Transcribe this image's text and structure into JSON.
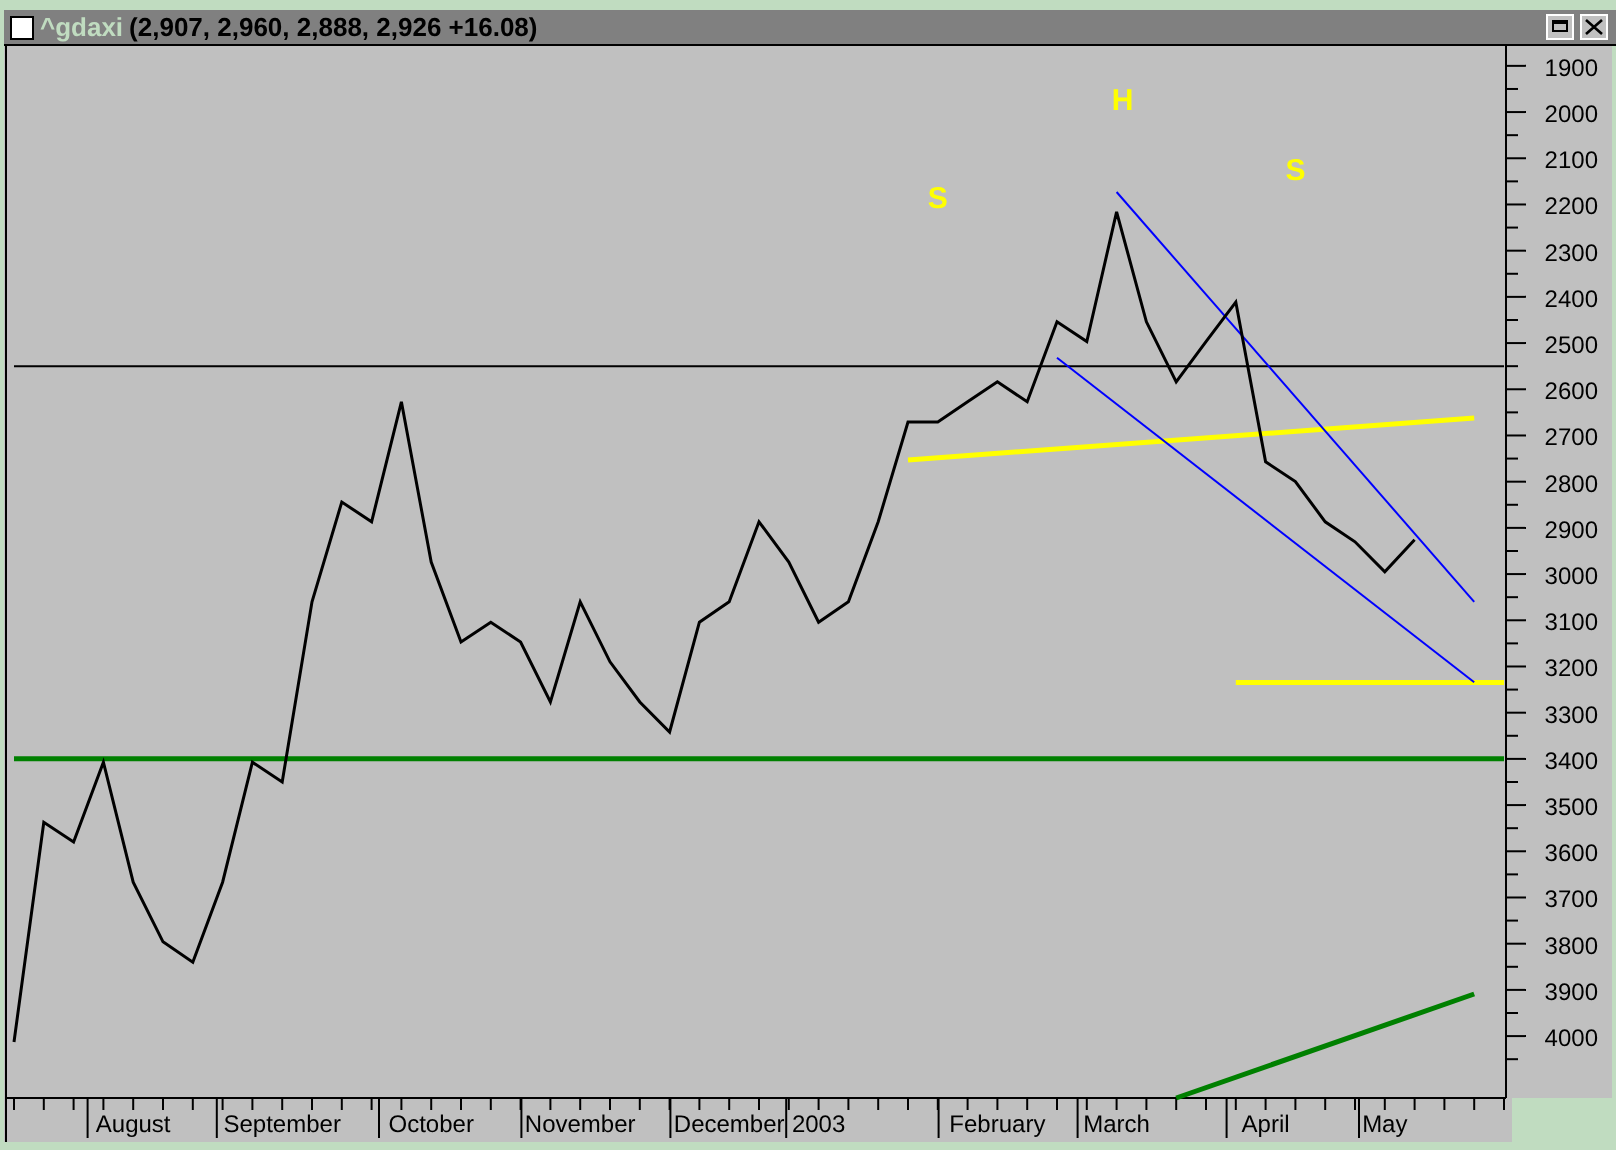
{
  "window": {
    "quote": "(2,907, 2,960, 2,888, 2,926 +16.08)"
  },
  "chart": {
    "chart_data": {
      "type": "line",
      "categories": [
        null,
        null,
        null,
        null,
        "August",
        null,
        null,
        null,
        null,
        "September",
        null,
        null,
        null,
        null,
        "October",
        null,
        null,
        null,
        null,
        "November",
        null,
        null,
        null,
        null,
        "December",
        null,
        null,
        "2003",
        null,
        null,
        null,
        null,
        null,
        "February",
        null,
        null,
        null,
        "March",
        null,
        null,
        null,
        null,
        "April",
        null,
        null,
        null,
        "May",
        null,
        null,
        null,
        null
      ],
      "series": [
        {
          "name": "^gdaxi",
          "color": "#000000",
          "values": [
            4013,
            3537,
            3580,
            3407,
            3667,
            3796,
            3840,
            3667,
            3407,
            3450,
            3060,
            2844,
            2887,
            2627,
            2974,
            3147,
            3104,
            3147,
            3277,
            3060,
            3190,
            3277,
            3342,
            3104,
            3060,
            2887,
            2974,
            3104,
            3060,
            2887,
            2671,
            2671,
            2627,
            2584,
            2627,
            2454,
            2497,
            2216,
            2454,
            2584,
            2497,
            2411,
            2757,
            2800,
            2887,
            2930,
            2995,
            2926,
            null,
            null,
            null
          ]
        },
        {
          "color": "#000000",
          "values": [
            2550,
            2550,
            2550,
            2550,
            2550,
            2550,
            2550,
            2550,
            2550,
            2550,
            2550,
            2550,
            2550,
            2550,
            2550,
            2550,
            2550,
            2550,
            2550,
            2550,
            2550,
            2550,
            2550,
            2550,
            2550,
            2550,
            2550,
            2550,
            2550,
            2550,
            2550,
            2550,
            2550,
            2550,
            2550,
            2550,
            2550,
            2550,
            2550,
            2550,
            2550,
            2550,
            2550,
            2550,
            2550,
            2550,
            2550,
            2550,
            2550,
            2550,
            2550
          ]
        },
        {
          "color": "#008000",
          "values": [
            3400,
            3400,
            3400,
            3400,
            3400,
            3400,
            3400,
            3400,
            3400,
            3400,
            3400,
            3400,
            3400,
            3400,
            3400,
            3400,
            3400,
            3400,
            3400,
            3400,
            3400,
            3400,
            3400,
            3400,
            3400,
            3400,
            3400,
            3400,
            3400,
            3400,
            3400,
            3400,
            3400,
            3400,
            3400,
            3400,
            3400,
            3400,
            3400,
            3400,
            3400,
            3400,
            3400,
            3400,
            3400,
            3400,
            3400,
            3400,
            3400,
            3400,
            3400
          ]
        },
        {
          "color": "#ffff00",
          "values": [
            null,
            null,
            null,
            null,
            null,
            null,
            null,
            null,
            null,
            null,
            null,
            null,
            null,
            null,
            null,
            null,
            null,
            null,
            null,
            null,
            null,
            null,
            null,
            null,
            null,
            null,
            null,
            null,
            null,
            null,
            2753,
            null,
            null,
            null,
            null,
            null,
            null,
            null,
            null,
            null,
            null,
            null,
            null,
            null,
            null,
            null,
            null,
            null,
            null,
            2662,
            null
          ]
        },
        {
          "color": "#ffff00",
          "values": [
            null,
            null,
            null,
            null,
            null,
            null,
            null,
            null,
            null,
            null,
            null,
            null,
            null,
            null,
            null,
            null,
            null,
            null,
            null,
            null,
            null,
            null,
            null,
            null,
            null,
            null,
            null,
            null,
            null,
            null,
            null,
            null,
            null,
            null,
            null,
            null,
            null,
            null,
            null,
            null,
            null,
            3235,
            null,
            null,
            null,
            null,
            null,
            null,
            null,
            null,
            3235
          ]
        },
        {
          "color": "#0000ff",
          "values": [
            null,
            null,
            null,
            null,
            null,
            null,
            null,
            null,
            null,
            null,
            null,
            null,
            null,
            null,
            null,
            null,
            null,
            null,
            null,
            null,
            null,
            null,
            null,
            null,
            null,
            null,
            null,
            null,
            null,
            null,
            null,
            null,
            null,
            null,
            null,
            null,
            null,
            2173,
            null,
            null,
            null,
            null,
            null,
            null,
            null,
            null,
            null,
            null,
            null,
            3060,
            null
          ]
        },
        {
          "color": "#0000ff",
          "values": [
            null,
            null,
            null,
            null,
            null,
            null,
            null,
            null,
            null,
            null,
            null,
            null,
            null,
            null,
            null,
            null,
            null,
            null,
            null,
            null,
            null,
            null,
            null,
            null,
            null,
            null,
            null,
            null,
            null,
            null,
            null,
            null,
            null,
            null,
            null,
            2532,
            null,
            null,
            null,
            null,
            null,
            null,
            null,
            null,
            null,
            null,
            null,
            null,
            null,
            3234,
            null
          ]
        },
        {
          "color": "#008000",
          "values": [
            null,
            null,
            null,
            null,
            null,
            null,
            null,
            null,
            null,
            null,
            null,
            null,
            null,
            null,
            null,
            null,
            null,
            null,
            null,
            null,
            null,
            null,
            null,
            null,
            null,
            null,
            null,
            null,
            null,
            null,
            null,
            null,
            null,
            null,
            null,
            null,
            null,
            null,
            null,
            4134,
            null,
            null,
            null,
            null,
            null,
            null,
            null,
            null,
            null,
            3909,
            null
          ]
        }
      ],
      "ylim": [
        4134,
        1857
      ],
      "yticks": [
        1900,
        2000,
        2100,
        2200,
        2300,
        2400,
        2500,
        2600,
        2700,
        2800,
        2900,
        3000,
        3100,
        3200,
        3300,
        3400,
        3500,
        3600,
        3700,
        3800,
        3900,
        4000
      ],
      "annotations": [
        "S",
        "H",
        "S"
      ]
    }
  }
}
